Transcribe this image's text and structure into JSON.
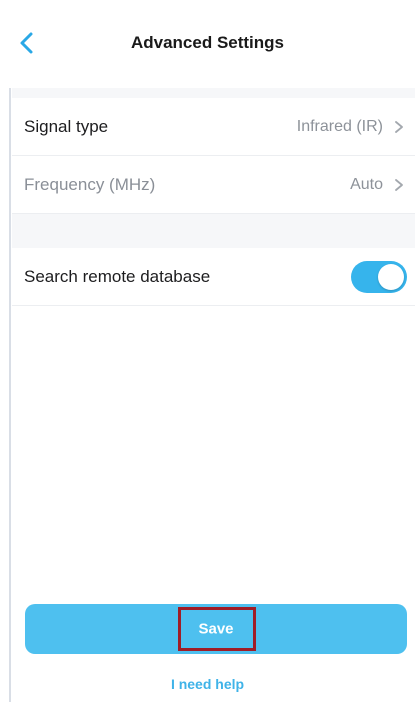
{
  "header": {
    "title": "Advanced Settings",
    "back_icon": "chevron-left-icon"
  },
  "settings": {
    "signal_type": {
      "label": "Signal type",
      "value": "Infrared (IR)"
    },
    "frequency": {
      "label": "Frequency (MHz)",
      "value": "Auto"
    },
    "search_remote": {
      "label": "Search remote database",
      "enabled": true
    }
  },
  "actions": {
    "save_label": "Save",
    "help_label": "I need help"
  },
  "colors": {
    "accent": "#4ec0ef",
    "toggle_on": "#36b4ec",
    "highlight_border": "#a01d27",
    "link": "#3fb3e8"
  }
}
